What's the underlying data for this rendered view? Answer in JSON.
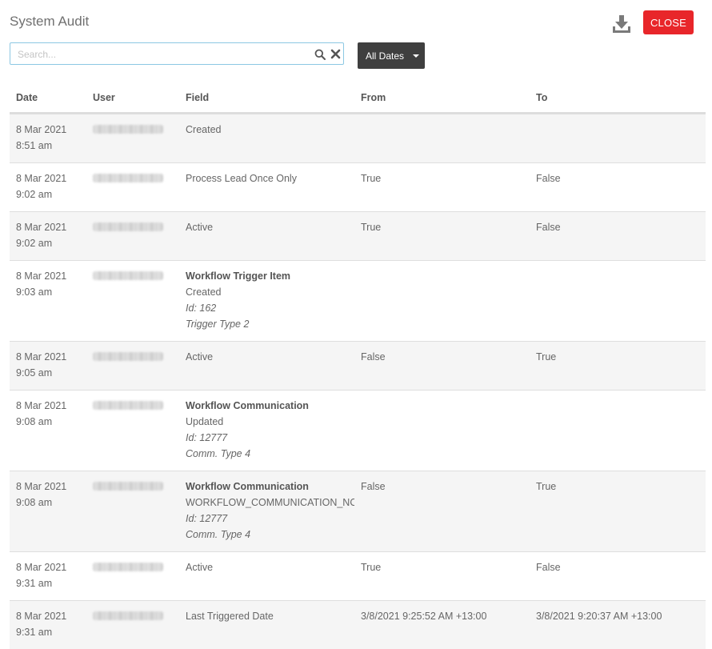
{
  "header": {
    "title": "System Audit",
    "download_icon": "download-icon",
    "close_label": "CLOSE",
    "close_color": "#e8262a"
  },
  "search": {
    "placeholder": "Search...",
    "value": "",
    "search_icon": "search-icon",
    "clear_icon": "clear-icon"
  },
  "date_filter": {
    "label": "All Dates",
    "caret_icon": "caret-down-icon"
  },
  "table": {
    "columns": [
      "Date",
      "User",
      "Field",
      "From",
      "To"
    ],
    "rows": [
      {
        "date": "8 Mar 2021",
        "time": "8:51 am",
        "field": "Created",
        "from": "",
        "to": ""
      },
      {
        "date": "8 Mar 2021",
        "time": "9:02 am",
        "field": "Process Lead Once Only",
        "from": "True",
        "to": "False"
      },
      {
        "date": "8 Mar 2021",
        "time": "9:02 am",
        "field": "Active",
        "from": "True",
        "to": "False"
      },
      {
        "date": "8 Mar 2021",
        "time": "9:03 am",
        "field_title": "Workflow Trigger Item",
        "field": "Created",
        "field_id": "Id: 162",
        "field_type": "Trigger Type 2",
        "from": "",
        "to": ""
      },
      {
        "date": "8 Mar 2021",
        "time": "9:05 am",
        "field": "Active",
        "from": "False",
        "to": "True"
      },
      {
        "date": "8 Mar 2021",
        "time": "9:08 am",
        "field_title": "Workflow Communication",
        "field": "Updated",
        "field_id": "Id: 12777",
        "field_type": "Comm. Type 4",
        "from": "",
        "to": ""
      },
      {
        "date": "8 Mar 2021",
        "time": "9:08 am",
        "field_title": "Workflow Communication",
        "field": "WORKFLOW_COMMUNICATION_NOT",
        "field_id": "Id: 12777",
        "field_type": "Comm. Type 4",
        "from": "False",
        "to": "True"
      },
      {
        "date": "8 Mar 2021",
        "time": "9:31 am",
        "field": "Active",
        "from": "True",
        "to": "False"
      },
      {
        "date": "8 Mar 2021",
        "time": "9:31 am",
        "field": "Last Triggered Date",
        "from": "3/8/2021 9:25:52 AM +13:00",
        "to": "3/8/2021 9:20:37 AM +13:00"
      }
    ]
  }
}
